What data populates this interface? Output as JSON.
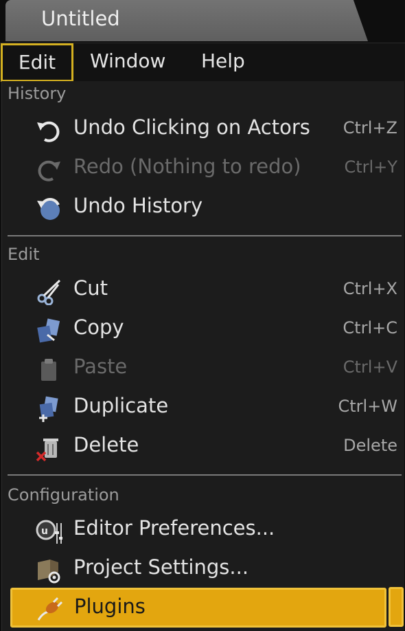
{
  "window": {
    "tab_title": "Untitled"
  },
  "menubar": {
    "edit": "Edit",
    "window": "Window",
    "help": "Help"
  },
  "sections": {
    "history": "History",
    "edit": "Edit",
    "configuration": "Configuration"
  },
  "items": {
    "undo": {
      "label": "Undo Clicking on Actors",
      "shortcut": "Ctrl+Z"
    },
    "redo": {
      "label": "Redo (Nothing to redo)",
      "shortcut": "Ctrl+Y"
    },
    "undo_history": {
      "label": "Undo History"
    },
    "cut": {
      "label": "Cut",
      "shortcut": "Ctrl+X"
    },
    "copy": {
      "label": "Copy",
      "shortcut": "Ctrl+C"
    },
    "paste": {
      "label": "Paste",
      "shortcut": "Ctrl+V"
    },
    "duplicate": {
      "label": "Duplicate",
      "shortcut": "Ctrl+W"
    },
    "delete": {
      "label": "Delete",
      "shortcut": "Delete"
    },
    "editor_preferences": {
      "label": "Editor Preferences..."
    },
    "project_settings": {
      "label": "Project Settings..."
    },
    "plugins": {
      "label": "Plugins"
    }
  },
  "colors": {
    "accent": "#e3a60f",
    "accent_border": "#f0c23a",
    "menu_bg": "#1c1c1c"
  }
}
